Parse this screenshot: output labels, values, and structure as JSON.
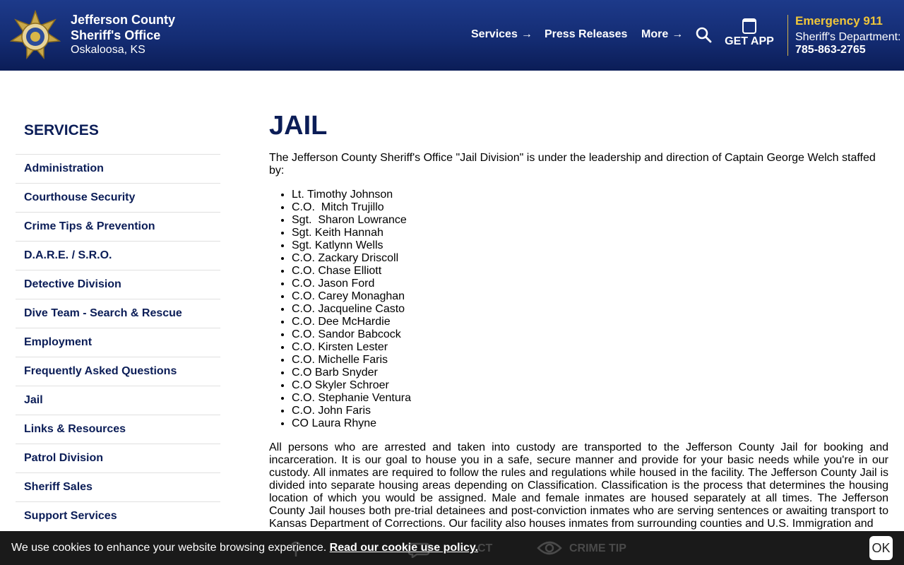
{
  "header": {
    "brand_name": "Jefferson County Sheriff's Office",
    "brand_location": "Oskaloosa, KS",
    "nav": {
      "services": "Services",
      "press_releases": "Press Releases",
      "more": "More"
    },
    "get_app": "GET APP",
    "emergency": "Emergency 911",
    "dept_label": "Sheriff's Department:",
    "dept_phone": "785-863-2765"
  },
  "sidebar": {
    "title": "SERVICES",
    "items": [
      "Administration",
      "Courthouse Security",
      "Crime Tips & Prevention",
      "D.A.R.E. / S.R.O.",
      "Detective Division",
      "Dive Team - Search & Rescue",
      "Employment",
      "Frequently Asked Questions",
      "Jail",
      "Links & Resources",
      "Patrol Division",
      "Sheriff Sales",
      "Support Services"
    ]
  },
  "main": {
    "title": "JAIL",
    "intro": "The Jefferson County Sheriff's Office \"Jail Division\" is under the leadership and direction of Captain George Welch staffed by:",
    "staff": [
      "Lt. Timothy Johnson",
      "C.O.  Mitch Trujillo",
      "Sgt.  Sharon Lowrance",
      "Sgt. Keith Hannah",
      "Sgt. Katlynn Wells",
      "C.O. Zackary Driscoll",
      "C.O. Chase Elliott",
      "C.O. Jason Ford",
      "C.O. Carey Monaghan",
      "C.O. Jacqueline Casto",
      "C.O. Dee McHardie",
      "C.O. Sandor Babcock",
      "C.O. Kirsten Lester",
      "C.O. Michelle Faris",
      "C.O Barb Snyder",
      "C.O Skyler Schroer",
      "C.O. Stephanie Ventura",
      "C.O. John Faris",
      "CO Laura Rhyne"
    ],
    "body": "All persons who are arrested and taken into custody are transported to the Jefferson County Jail for booking and incarceration. It is our goal to house you in a safe, secure manner and provide for your basic needs while you're in our custody. All inmates are required to follow the rules and regulations while housed in the facility. The Jefferson County Jail is divided into separate housing areas depending on Classification. Classification is the process that determines the housing location of which you would be assigned. Male and female inmates are housed separately at all times. The Jefferson County Jail houses both pre-trial detainees and post-conviction inmates who are serving sentences or awaiting transport to Kansas Department of Corrections. Our facility also houses inmates from surrounding counties and U.S. Immigration and"
  },
  "bottom_bar": {
    "contact_partial": "CT",
    "crime_tip": "CRIME TIP"
  },
  "cookie": {
    "text": "We use cookies to enhance your website browsing experience.",
    "link": "Read our cookie use policy.",
    "ok": "OK"
  },
  "colors": {
    "header_blue": "#142c73",
    "navy_text": "#0b1d57",
    "emergency_gold": "#f0c63a"
  },
  "icons": {
    "badge": "sheriff-star-badge",
    "search": "search-icon",
    "phone": "phone-icon",
    "eye": "eye-icon"
  }
}
